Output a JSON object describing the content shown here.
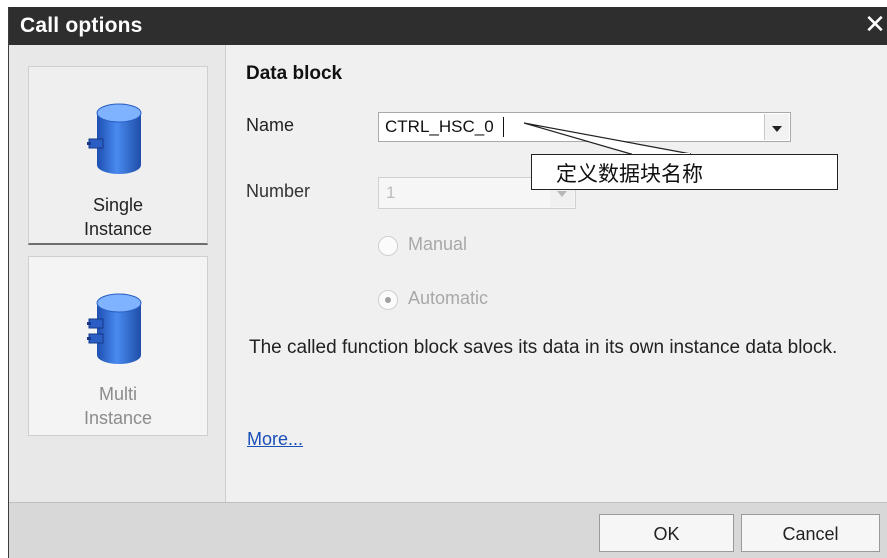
{
  "dialog": {
    "title": "Call options",
    "close_icon": "close-icon"
  },
  "tiles": [
    {
      "label_line1": "Single",
      "label_line2": "Instance",
      "icon": "database-single-icon",
      "selected": true
    },
    {
      "label_line1": "Multi",
      "label_line2": "Instance",
      "icon": "database-multi-icon",
      "selected": false
    }
  ],
  "data_block": {
    "section_title": "Data block",
    "name_label": "Name",
    "name_value": "CTRL_HSC_0",
    "number_label": "Number",
    "number_value": "1",
    "radio_manual": "Manual",
    "radio_automatic": "Automatic",
    "radio_selected": "Automatic",
    "description": "The called function block saves its data in its own instance data block.",
    "more_link": "More..."
  },
  "annotation": {
    "text": "定义数据块名称"
  },
  "footer": {
    "ok_label": "OK",
    "cancel_label": "Cancel"
  },
  "colors": {
    "title_bar": "#2e2e2e",
    "db_icon_blue": "#2f6fd6",
    "link": "#1a4fb8"
  }
}
